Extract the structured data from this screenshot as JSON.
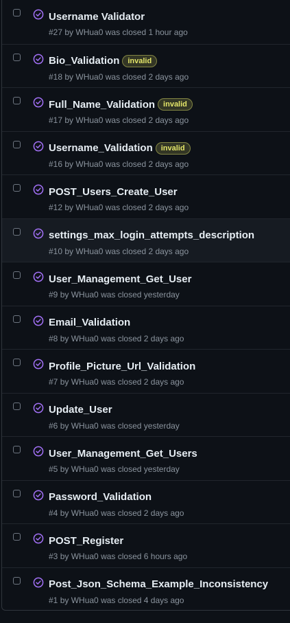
{
  "colors": {
    "background": "#0d1117",
    "closed_icon": "#a371f7",
    "label_invalid": "#e4e669",
    "muted_text": "#8b949e"
  },
  "issues": [
    {
      "title": "Username Validator",
      "number": "#27",
      "author": "WHua0",
      "closed_text": "was closed 1 hour ago",
      "labels": [],
      "icon": "closed-issue-icon"
    },
    {
      "title": "Bio_Validation",
      "number": "#18",
      "author": "WHua0",
      "closed_text": "was closed 2 days ago",
      "labels": [
        "invalid"
      ],
      "icon": "closed-issue-icon"
    },
    {
      "title": "Full_Name_Validation",
      "number": "#17",
      "author": "WHua0",
      "closed_text": "was closed 2 days ago",
      "labels": [
        "invalid"
      ],
      "icon": "closed-issue-icon"
    },
    {
      "title": "Username_Validation",
      "number": "#16",
      "author": "WHua0",
      "closed_text": "was closed 2 days ago",
      "labels": [
        "invalid"
      ],
      "icon": "closed-issue-icon"
    },
    {
      "title": "POST_Users_Create_User",
      "number": "#12",
      "author": "WHua0",
      "closed_text": "was closed 2 days ago",
      "labels": [],
      "icon": "closed-issue-icon"
    },
    {
      "title": "settings_max_login_attempts_description",
      "number": "#10",
      "author": "WHua0",
      "closed_text": "was closed 2 days ago",
      "labels": [],
      "icon": "closed-issue-icon",
      "hovered": true
    },
    {
      "title": "User_Management_Get_User",
      "number": "#9",
      "author": "WHua0",
      "closed_text": "was closed yesterday",
      "labels": [],
      "icon": "closed-issue-icon"
    },
    {
      "title": "Email_Validation",
      "number": "#8",
      "author": "WHua0",
      "closed_text": "was closed 2 days ago",
      "labels": [],
      "icon": "closed-issue-icon"
    },
    {
      "title": "Profile_Picture_Url_Validation",
      "number": "#7",
      "author": "WHua0",
      "closed_text": "was closed 2 days ago",
      "labels": [],
      "icon": "closed-issue-icon"
    },
    {
      "title": "Update_User",
      "number": "#6",
      "author": "WHua0",
      "closed_text": "was closed yesterday",
      "labels": [],
      "icon": "closed-issue-icon"
    },
    {
      "title": "User_Management_Get_Users",
      "number": "#5",
      "author": "WHua0",
      "closed_text": "was closed yesterday",
      "labels": [],
      "icon": "closed-issue-icon"
    },
    {
      "title": "Password_Validation",
      "number": "#4",
      "author": "WHua0",
      "closed_text": "was closed 2 days ago",
      "labels": [],
      "icon": "closed-issue-icon"
    },
    {
      "title": "POST_Register",
      "number": "#3",
      "author": "WHua0",
      "closed_text": "was closed 6 hours ago",
      "labels": [],
      "icon": "closed-issue-icon"
    },
    {
      "title": "Post_Json_Schema_Example_Inconsistency",
      "number": "#1",
      "author": "WHua0",
      "closed_text": "was closed 4 days ago",
      "labels": [],
      "icon": "closed-issue-icon"
    }
  ]
}
